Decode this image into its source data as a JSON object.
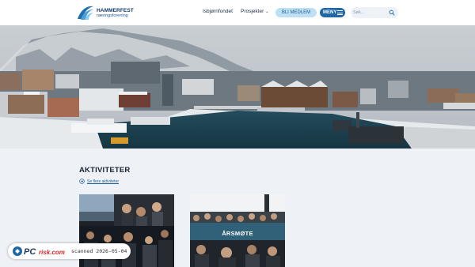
{
  "header": {
    "logo_title": "HAMMERFEST",
    "logo_subtitle": "næringsforening",
    "nav": [
      {
        "label": "Isbjørnfondet"
      },
      {
        "label": "Prosjekter"
      }
    ],
    "member_button": "BLI MEDLEM",
    "menu_button": "MENY",
    "search_placeholder": "Søk...",
    "brand_color": "#1f67a6"
  },
  "hero": {
    "image": "harbor-town-snow-photo"
  },
  "activities": {
    "title": "AKTIVITETER",
    "more_link": "Se flere aktiviteter",
    "cards": [
      {
        "label": "",
        "image": "conference-audience-photo"
      },
      {
        "label": "ÅRSMØTE",
        "image": "annual-meeting-audience-photo"
      }
    ]
  },
  "watermark": {
    "text": "scanned 2026-05-04"
  }
}
